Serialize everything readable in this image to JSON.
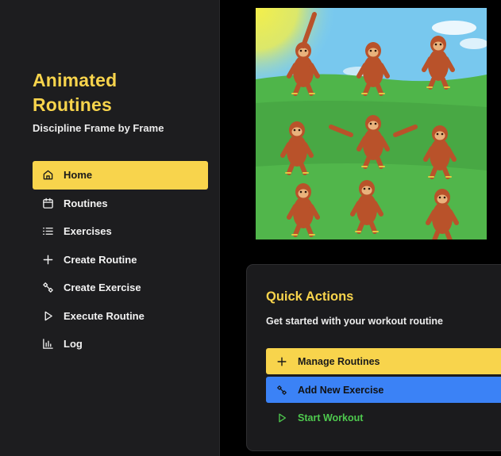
{
  "brand": {
    "title_line1": "Animated",
    "title_line2": "Routines",
    "subtitle": "Discipline Frame by Frame"
  },
  "nav": {
    "items": [
      {
        "label": "Home",
        "icon": "home-icon",
        "active": true
      },
      {
        "label": "Routines",
        "icon": "calendar-icon"
      },
      {
        "label": "Exercises",
        "icon": "list-icon"
      },
      {
        "label": "Create Routine",
        "icon": "plus-icon"
      },
      {
        "label": "Create Exercise",
        "icon": "dumbbell-icon"
      },
      {
        "label": "Execute Routine",
        "icon": "play-icon"
      },
      {
        "label": "Log",
        "icon": "bar-chart-icon"
      }
    ]
  },
  "quick_actions": {
    "title": "Quick Actions",
    "subtitle": "Get started with your workout routine",
    "manage_label": "Manage Routines",
    "add_label": "Add New Exercise",
    "start_label": "Start Workout"
  },
  "colors": {
    "accent_yellow": "#f8d44c",
    "accent_blue": "#3b82f6",
    "accent_green": "#4ec94e",
    "sidebar_bg": "#1d1d1f",
    "page_bg": "#000000"
  }
}
